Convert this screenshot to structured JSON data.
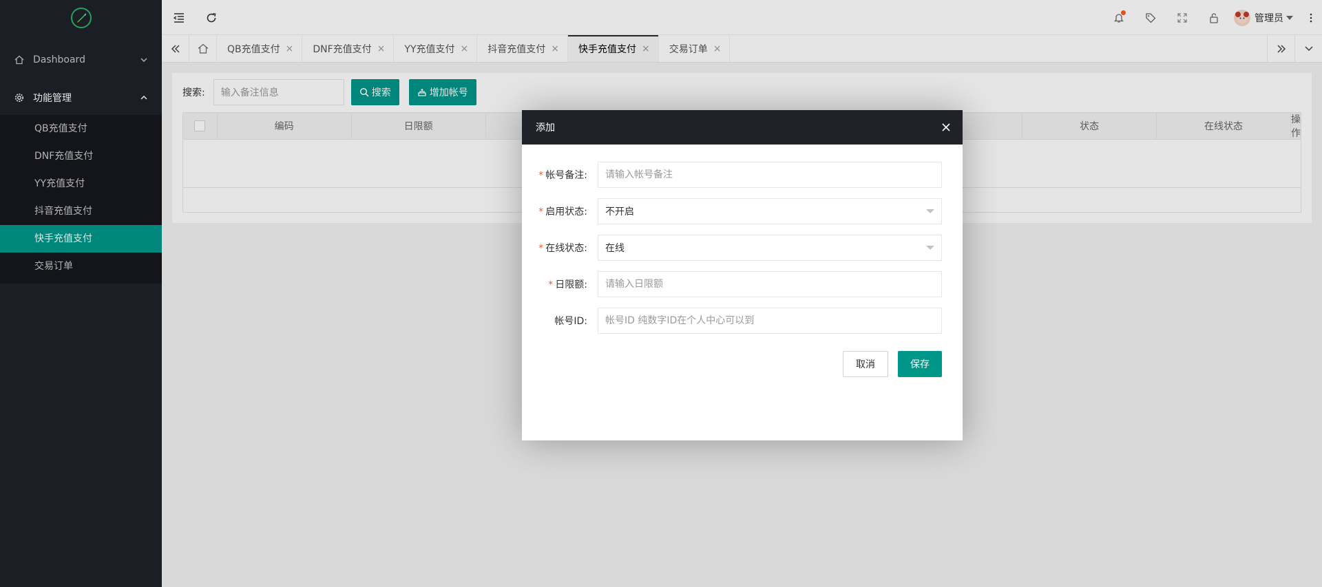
{
  "sidebar": {
    "menu": [
      {
        "label": "Dashboard",
        "icon": "home-icon",
        "expanded": false
      },
      {
        "label": "功能管理",
        "icon": "gear-icon",
        "expanded": true
      }
    ],
    "submenu": [
      {
        "label": "QB充值支付",
        "active": false
      },
      {
        "label": "DNF充值支付",
        "active": false
      },
      {
        "label": "YY充值支付",
        "active": false
      },
      {
        "label": "抖音充值支付",
        "active": false
      },
      {
        "label": "快手充值支付",
        "active": true
      },
      {
        "label": "交易订单",
        "active": false
      }
    ]
  },
  "header": {
    "user_name": "管理员",
    "notification_dot": true
  },
  "tabs": [
    {
      "label": "QB充值支付",
      "close": "×",
      "active": false
    },
    {
      "label": "DNF充值支付",
      "close": "×",
      "active": false
    },
    {
      "label": "YY充值支付",
      "close": "×",
      "active": false
    },
    {
      "label": "抖音充值支付",
      "close": "×",
      "active": false
    },
    {
      "label": "快手充值支付",
      "close": "×",
      "active": true
    },
    {
      "label": "交易订单",
      "close": "×",
      "active": false
    }
  ],
  "search": {
    "label": "搜索:",
    "placeholder": "输入备注信息",
    "search_button": "搜索",
    "add_button": "增加帐号"
  },
  "table": {
    "columns": [
      "编码",
      "日限额",
      "",
      "",
      "",
      "",
      "状态",
      "在线状态",
      "操作"
    ]
  },
  "modal": {
    "title": "添加",
    "fields": [
      {
        "label": "帐号备注:",
        "required": "*",
        "type": "input",
        "placeholder": "请输入帐号备注",
        "value": ""
      },
      {
        "label": "启用状态:",
        "required": "*",
        "type": "select",
        "value": "不开启"
      },
      {
        "label": "在线状态:",
        "required": "*",
        "type": "select",
        "value": "在线"
      },
      {
        "label": "日限额:",
        "required": "*",
        "type": "input",
        "placeholder": "请输入日限额",
        "value": ""
      },
      {
        "label": "帐号ID:",
        "required": "",
        "type": "input",
        "placeholder": "帐号ID 纯数字ID在个人中心可以到",
        "value": ""
      }
    ],
    "cancel_label": "取消",
    "save_label": "保存"
  },
  "colors": {
    "accent": "#009688",
    "sidebar_bg": "#20222a",
    "required": "#ff5722"
  }
}
